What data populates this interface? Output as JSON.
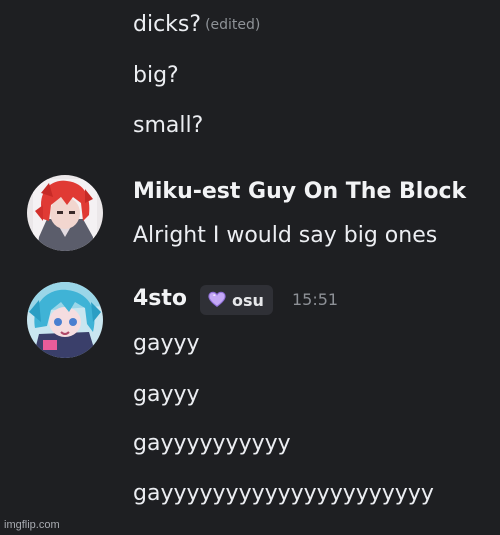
{
  "messages_top": [
    {
      "text": "dicks?",
      "edited": "(edited)"
    },
    {
      "text": "big?"
    },
    {
      "text": "small?"
    }
  ],
  "message_group_1": {
    "author": "Miku-est Guy On The Block",
    "avatar": "avatar-red-hair-anime",
    "lines": [
      "Alright I would say big ones"
    ]
  },
  "message_group_2": {
    "author": "4sto",
    "badge": {
      "icon": "purple-heart-icon",
      "label": "osu"
    },
    "timestamp": "15:51",
    "avatar": "avatar-blue-hair-anime",
    "lines": [
      "gayyy",
      "gayyy",
      "gayyyyyyyyyy",
      "gayyyyyyyyyyyyyyyyyyyyy"
    ]
  },
  "watermark": "imgflip.com",
  "colors": {
    "background": "#1e1f22",
    "text": "#eceef2",
    "muted": "#8d9096",
    "badge_bg": "#2f3036",
    "heart": "#b89cf2"
  }
}
